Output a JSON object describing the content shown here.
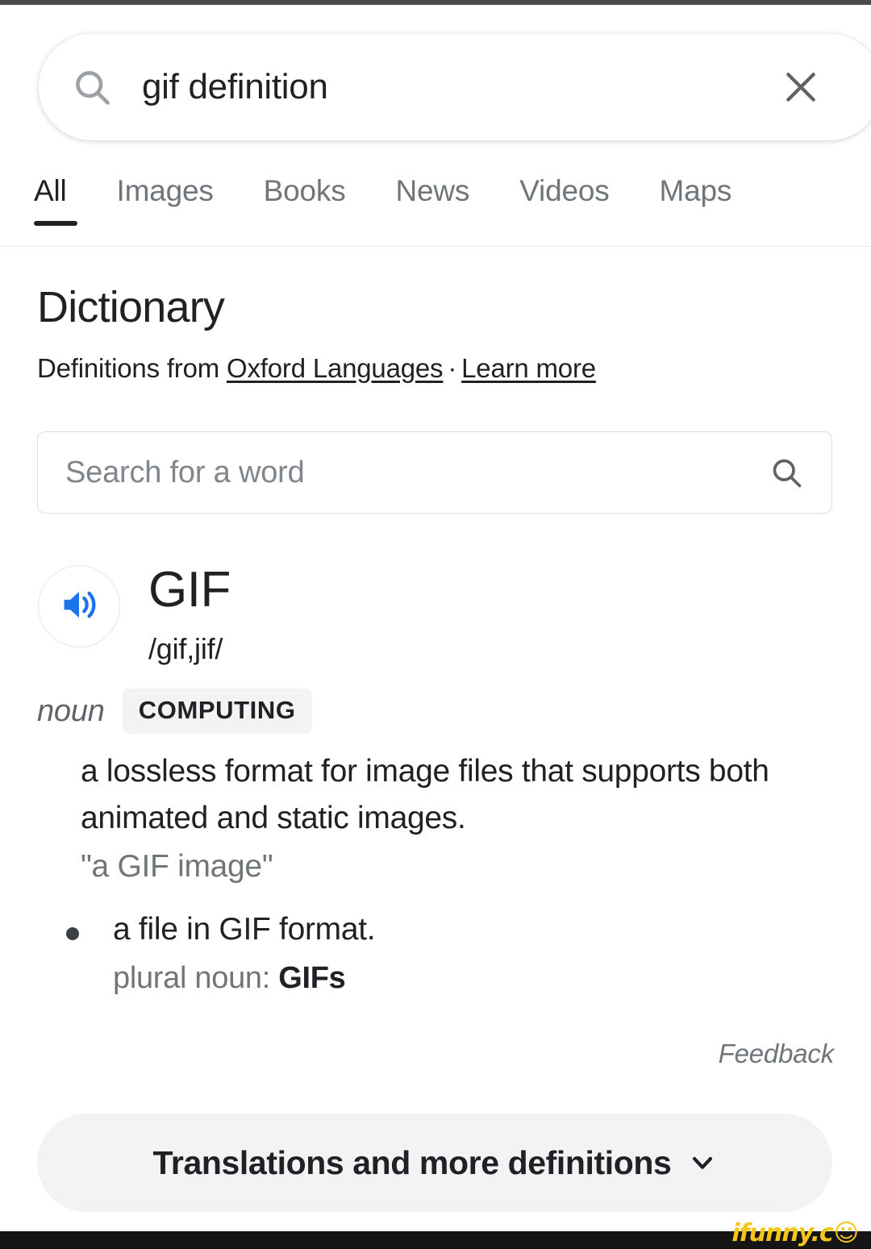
{
  "search": {
    "query": "gif definition",
    "search_icon": "search-icon",
    "clear_icon": "close-icon"
  },
  "tabs": [
    {
      "label": "All",
      "active": true
    },
    {
      "label": "Images",
      "active": false
    },
    {
      "label": "Books",
      "active": false
    },
    {
      "label": "News",
      "active": false
    },
    {
      "label": "Videos",
      "active": false
    },
    {
      "label": "Maps",
      "active": false
    }
  ],
  "dictionary": {
    "title": "Dictionary",
    "attribution_prefix": "Definitions from ",
    "source_link": "Oxford Languages",
    "separator": "·",
    "learn_more_link": "Learn more",
    "word_search_placeholder": "Search for a word",
    "word_search_value": "",
    "word_search_icon": "search-icon",
    "speaker_icon": "volume-up-icon",
    "headword": "GIF",
    "phonetic": "/gif,jif/",
    "part_of_speech": "noun",
    "domain_badge": "COMPUTING",
    "senses": [
      {
        "definition": "a lossless format for image files that supports both animated and static images.",
        "example": "\"a GIF image\""
      }
    ],
    "subsenses": [
      {
        "definition": "a file in GIF format.",
        "plural_label": "plural noun: ",
        "plural_value": "GIFs"
      }
    ],
    "feedback_label": "Feedback",
    "expand_label": "Translations and more definitions",
    "expand_icon": "chevron-down-icon"
  },
  "watermark": {
    "text": "ifunny.c",
    "smiley": "☺",
    "color": "#f5c518"
  },
  "colors": {
    "accent_blue": "#1a73e8",
    "text_primary": "#202124",
    "text_secondary": "#70757a",
    "badge_bg": "#f1f3f4",
    "border": "#dadce0"
  }
}
